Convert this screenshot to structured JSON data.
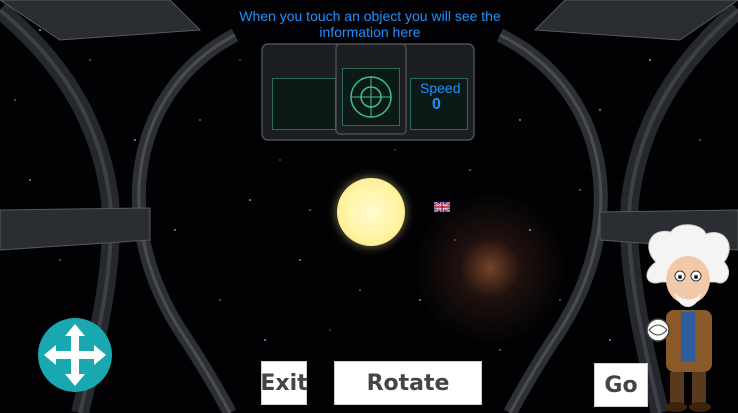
{
  "hud": {
    "info_text": "When you touch an object you will see the information here",
    "speed_label": "Speed",
    "speed_value": "0"
  },
  "controls": {
    "exit_label": "Exit",
    "rotate_label": "Rotate",
    "go_label": "Go",
    "joystick_icon": "move-arrows-icon"
  },
  "scene_objects": {
    "sun": "sun",
    "flag": "uk-flag-icon",
    "mascot": "einstein-mascot"
  },
  "colors": {
    "hud_text": "#1e90ff",
    "joystick": "#19a8b0",
    "sun": "#fff3a0"
  }
}
